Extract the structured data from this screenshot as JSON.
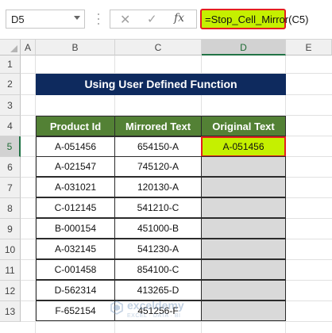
{
  "formula_bar": {
    "name_box": "D5",
    "cancel_icon": "✕",
    "enter_icon": "✓",
    "fx_label": "fx",
    "formula": "=Stop_Cell_Mirror(C5)"
  },
  "columns": [
    "A",
    "B",
    "C",
    "D",
    "E"
  ],
  "rows": [
    "1",
    "2",
    "3",
    "4",
    "5",
    "6",
    "7",
    "8",
    "9",
    "10",
    "11",
    "12",
    "13"
  ],
  "selected_cell": "D5",
  "title": "Using User Defined Function",
  "headers": [
    "Product Id",
    "Mirrored Text",
    "Original Text"
  ],
  "table": [
    [
      "A-051456",
      "654150-A",
      "A-051456"
    ],
    [
      "A-021547",
      "745120-A",
      ""
    ],
    [
      "A-031021",
      "120130-A",
      ""
    ],
    [
      "C-012145",
      "541210-C",
      ""
    ],
    [
      "B-000154",
      "451000-B",
      ""
    ],
    [
      "A-032145",
      "541230-A",
      ""
    ],
    [
      "C-001458",
      "854100-C",
      ""
    ],
    [
      "D-562314",
      "413265-D",
      ""
    ],
    [
      "F-652154",
      "451256-F",
      ""
    ]
  ],
  "watermark": {
    "name": "exceldemy",
    "tagline": "EXCEL · DATA · BI"
  },
  "colors": {
    "title_bg": "#0e2a5e",
    "header_bg": "#538135",
    "highlight": "#c5f000",
    "highlight_border": "#e41e1e",
    "empty_cell": "#d9d9d9"
  }
}
